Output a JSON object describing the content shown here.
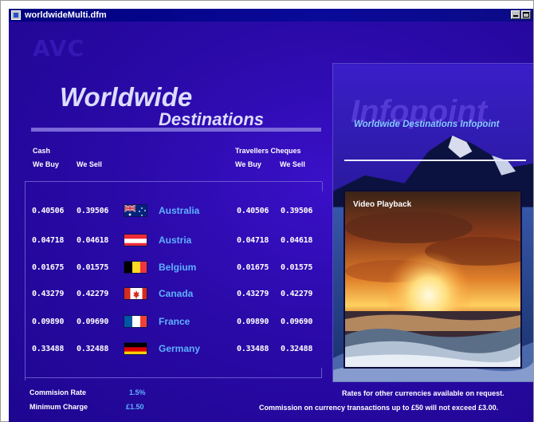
{
  "window": {
    "title": "worldwideMulti.dfm",
    "icon": "app-form-icon"
  },
  "logo": "AVC",
  "heading": {
    "line1": "Worldwide",
    "line2": "Destinations"
  },
  "headers": {
    "cash": "Cash",
    "cash_buy": "We Buy",
    "cash_sell": "We Sell",
    "cheques": "Travellers Cheques",
    "cheques_buy": "We Buy",
    "cheques_sell": "We Sell"
  },
  "rows": [
    {
      "cash_buy": "0.40506",
      "cash_sell": "0.39506",
      "country": "Australia",
      "flag": "australia-flag",
      "chq_buy": "0.40506",
      "chq_sell": "0.39506"
    },
    {
      "cash_buy": "0.04718",
      "cash_sell": "0.04618",
      "country": "Austria",
      "flag": "austria-flag",
      "chq_buy": "0.04718",
      "chq_sell": "0.04618"
    },
    {
      "cash_buy": "0.01675",
      "cash_sell": "0.01575",
      "country": "Belgium",
      "flag": "belgium-flag",
      "chq_buy": "0.01675",
      "chq_sell": "0.01575"
    },
    {
      "cash_buy": "0.43279",
      "cash_sell": "0.42279",
      "country": "Canada",
      "flag": "canada-flag",
      "chq_buy": "0.43279",
      "chq_sell": "0.42279"
    },
    {
      "cash_buy": "0.09890",
      "cash_sell": "0.09690",
      "country": "France",
      "flag": "france-flag",
      "chq_buy": "0.09890",
      "chq_sell": "0.09690"
    },
    {
      "cash_buy": "0.33488",
      "cash_sell": "0.32488",
      "country": "Germany",
      "flag": "germany-flag",
      "chq_buy": "0.33488",
      "chq_sell": "0.32488"
    }
  ],
  "commission": {
    "label": "Commision Rate",
    "value": "1.5%"
  },
  "minimum": {
    "label": "Minimum Charge",
    "value": "£1.50"
  },
  "infopoint": {
    "title": "Infopoint",
    "subtitle": "Worldwide Destinations Infopoint"
  },
  "video": {
    "label": "Video Playback"
  },
  "footer": {
    "line1": "Rates for other currencies available on request.",
    "line2": "Commission on currency transactions up to £50 will not exceed £3.00."
  },
  "colors": {
    "background": "#2a0aa8",
    "accent": "#5fb0ff",
    "titlebar": "#00007e"
  }
}
